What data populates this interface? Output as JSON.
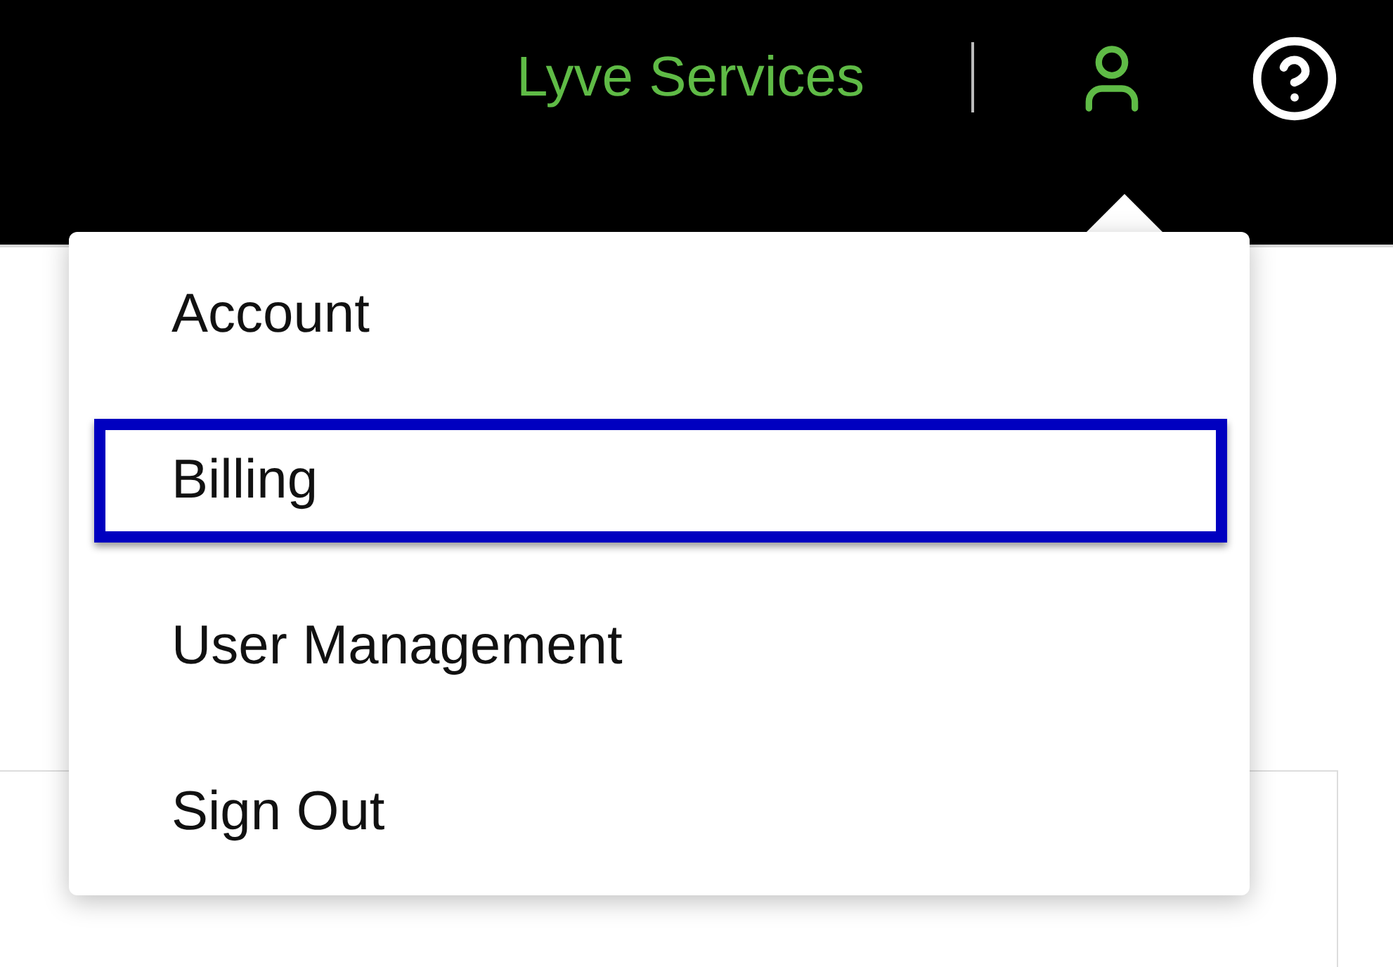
{
  "header": {
    "title": "Lyve Services"
  },
  "account_menu": {
    "items": [
      {
        "label": "Account",
        "highlighted": false
      },
      {
        "label": "Billing",
        "highlighted": true
      },
      {
        "label": "User Management",
        "highlighted": false
      },
      {
        "label": "Sign Out",
        "highlighted": false
      }
    ]
  }
}
